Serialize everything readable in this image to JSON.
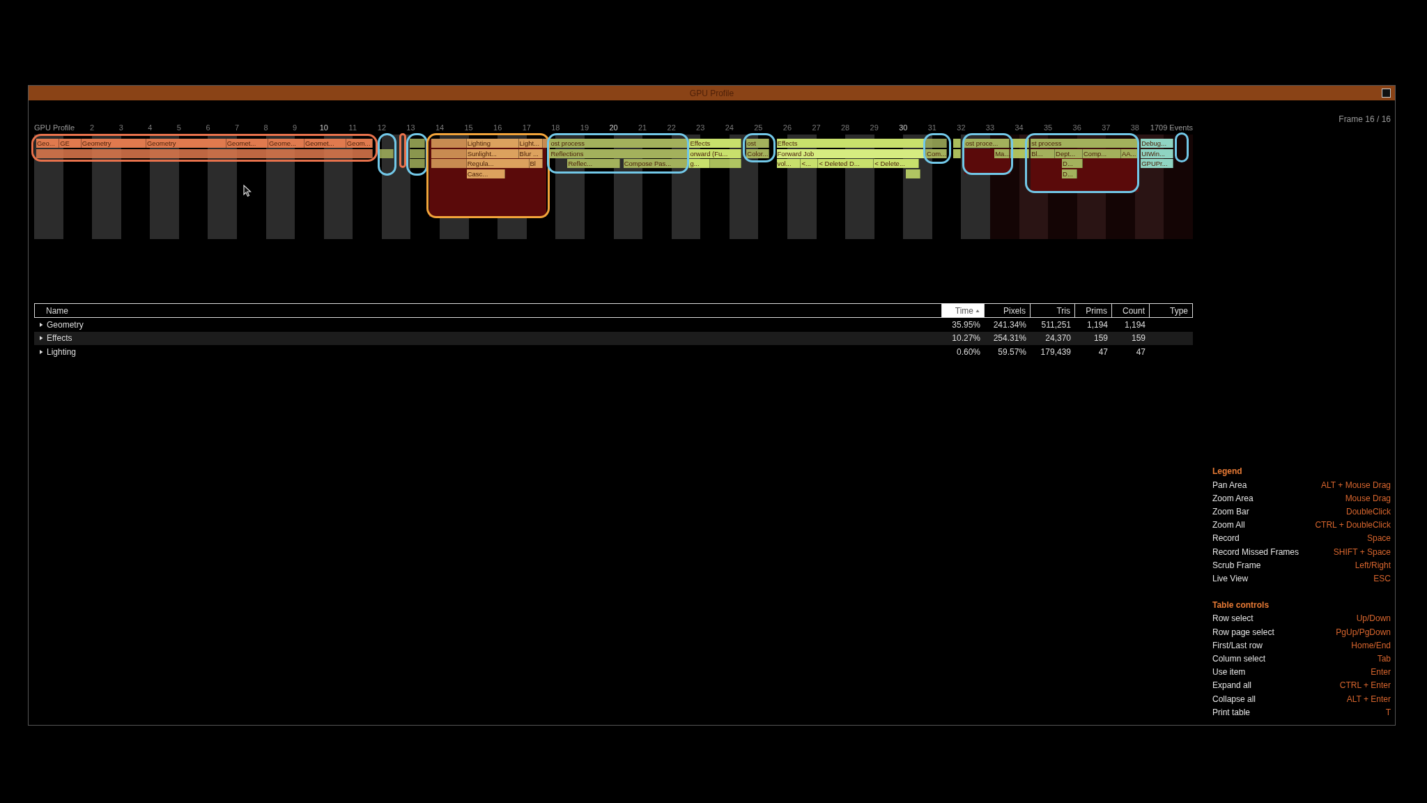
{
  "window": {
    "title": "GPU Profile"
  },
  "timeline": {
    "title": "GPU Profile",
    "frame_numbers": [
      "2",
      "3",
      "4",
      "5",
      "6",
      "7",
      "8",
      "9",
      "10",
      "11",
      "12",
      "13",
      "14",
      "15",
      "16",
      "17",
      "18",
      "19",
      "20",
      "21",
      "22",
      "23",
      "24",
      "25",
      "26",
      "27",
      "28",
      "29",
      "30",
      "31",
      "32",
      "33",
      "34",
      "35",
      "36",
      "37",
      "38"
    ],
    "events_count": "1709 Events",
    "frame_counter": "Frame 16 / 16",
    "events": [
      {
        "label": "Geo...",
        "color": "#e07a4e"
      },
      {
        "label": "GE",
        "color": "#e07a4e"
      },
      {
        "label": "Geometry",
        "color": "#e07a4e"
      },
      {
        "label": "Geometry",
        "color": "#e07a4e"
      },
      {
        "label": "Geomet...",
        "color": "#e07a4e"
      },
      {
        "label": "Geome...",
        "color": "#e07a4e"
      },
      {
        "label": "Geomet...",
        "color": "#e07a4e"
      },
      {
        "label": "Geom...",
        "color": "#e07a4e"
      },
      {
        "label": "Lighting",
        "color": "#dca25e"
      },
      {
        "label": "Light...",
        "color": "#dca25e"
      },
      {
        "label": "Sunlight...",
        "color": "#dca25e"
      },
      {
        "label": "Blur ...",
        "color": "#dca25e"
      },
      {
        "label": "Regula...",
        "color": "#dca25e"
      },
      {
        "label": "Bl",
        "color": "#dca25e"
      },
      {
        "label": "Casc...",
        "color": "#dca25e"
      },
      {
        "label": "ost process",
        "color": "#a3b15c"
      },
      {
        "label": "Reflections",
        "color": "#a3b15c"
      },
      {
        "label": "Reflec...",
        "color": "#a3b15c"
      },
      {
        "label": "Compose Pas...",
        "color": "#a3b15c"
      },
      {
        "label": "Effects",
        "color": "#c8e06c"
      },
      {
        "label": "orward (Fu...",
        "color": "#c8e06c"
      },
      {
        "label": "g...",
        "color": "#c8e06c"
      },
      {
        "label": "ost",
        "color": "#a3b15c"
      },
      {
        "label": "Color...",
        "color": "#a3b15c"
      },
      {
        "label": "Effects",
        "color": "#c8e06c"
      },
      {
        "label": "Forward Job",
        "color": "#d6ec80"
      },
      {
        "label": "vol...",
        "color": "#c8e06c"
      },
      {
        "label": "<...",
        "color": "#c8e06c"
      },
      {
        "label": "< Deleted D...",
        "color": "#c8e06c"
      },
      {
        "label": "< Delete...",
        "color": "#c8e06c"
      },
      {
        "label": "Com...",
        "color": "#a3b15c"
      },
      {
        "label": "ost proce...",
        "color": "#a3b15c"
      },
      {
        "label": "Ma...",
        "color": "#a3b15c"
      },
      {
        "label": "st process",
        "color": "#a3b15c"
      },
      {
        "label": "Bl...",
        "color": "#a3b15c"
      },
      {
        "label": "Dept...",
        "color": "#a3b15c"
      },
      {
        "label": "Comp...",
        "color": "#a3b15c"
      },
      {
        "label": "AA...",
        "color": "#a3b15c"
      },
      {
        "label": "D...",
        "color": "#a3b15c"
      },
      {
        "label": "D...",
        "color": "#a3b15c"
      },
      {
        "label": "Debug...",
        "color": "#8fd4c2"
      },
      {
        "label": "UIWin...",
        "color": "#8fd4c2"
      },
      {
        "label": "GPUPr...",
        "color": "#8fd4c2"
      }
    ]
  },
  "table": {
    "columns": [
      {
        "label": "Name",
        "selected": false
      },
      {
        "label": "Time",
        "selected": true
      },
      {
        "label": "Pixels",
        "selected": false
      },
      {
        "label": "Tris",
        "selected": false
      },
      {
        "label": "Prims",
        "selected": false
      },
      {
        "label": "Count",
        "selected": false
      },
      {
        "label": "Type",
        "selected": false
      }
    ],
    "rows": [
      {
        "expanded": false,
        "cells": [
          "Geometry",
          "35.95%",
          "241.34%",
          "511,251",
          "1,194",
          "1,194"
        ]
      },
      {
        "expanded": false,
        "cells": [
          "Effects",
          "10.27%",
          "254.31%",
          "24,370",
          "159",
          "159"
        ]
      },
      {
        "expanded": false,
        "cells": [
          "Lighting",
          "0.60%",
          "59.57%",
          "179,439",
          "47",
          "47"
        ]
      }
    ]
  },
  "legend": [
    {
      "title": "Legend",
      "items": [
        {
          "action": "Pan Area",
          "keys": "ALT + Mouse Drag"
        },
        {
          "action": "Zoom Area",
          "keys": "Mouse Drag"
        },
        {
          "action": "Zoom Bar",
          "keys": "DoubleClick"
        },
        {
          "action": "Zoom All",
          "keys": "CTRL + DoubleClick"
        },
        {
          "action": "Record",
          "keys": "Space"
        },
        {
          "action": "Record Missed Frames",
          "keys": "SHIFT + Space"
        },
        {
          "action": "Scrub Frame",
          "keys": "Left/Right"
        },
        {
          "action": "Live View",
          "keys": "ESC"
        }
      ]
    },
    {
      "title": "Table controls",
      "items": [
        {
          "action": "Row select",
          "keys": "Up/Down"
        },
        {
          "action": "Row page select",
          "keys": "PgUp/PgDown"
        },
        {
          "action": "First/Last row",
          "keys": "Home/End"
        },
        {
          "action": "Column select",
          "keys": "Tab"
        },
        {
          "action": "Use item",
          "keys": "Enter"
        },
        {
          "action": "Expand all",
          "keys": "CTRL + Enter"
        },
        {
          "action": "Collapse all",
          "keys": "ALT + Enter"
        },
        {
          "action": "Print table",
          "keys": "T"
        }
      ]
    }
  ]
}
